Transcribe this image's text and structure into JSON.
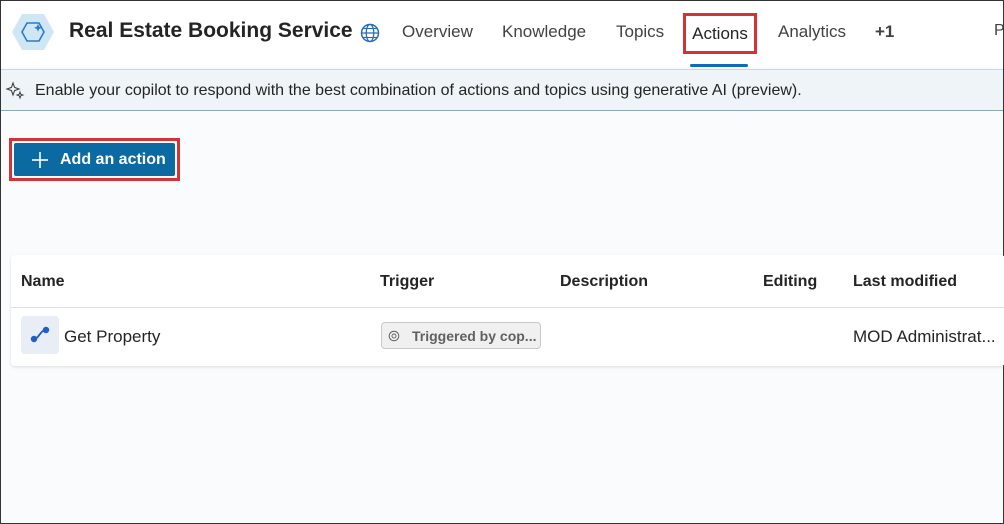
{
  "header": {
    "title": "Real Estate Booking Service",
    "app_icon": "copilot-hexagon-icon",
    "globe_icon": "globe-icon",
    "tabs": [
      {
        "label": "Overview"
      },
      {
        "label": "Knowledge"
      },
      {
        "label": "Topics"
      },
      {
        "label": "Actions",
        "active": true
      },
      {
        "label": "Analytics"
      },
      {
        "label": "+1"
      }
    ],
    "cut_tab_label": "P"
  },
  "banner": {
    "icon": "sparkle-icon",
    "text": "Enable your copilot to respond with the best combination of actions and topics using generative AI (preview)."
  },
  "toolbar": {
    "add_action_label": "Add an action",
    "add_icon": "plus-icon"
  },
  "table": {
    "columns": [
      "Name",
      "Trigger",
      "Description",
      "Editing",
      "Last modified"
    ],
    "rows": [
      {
        "icon": "flow-icon",
        "name": "Get Property",
        "trigger": "Triggered by cop...",
        "description": "",
        "editing": "",
        "last_modified": "MOD Administrat..."
      }
    ]
  },
  "colors": {
    "accent": "#0f6cbd",
    "button": "#0b6aa1",
    "highlight": "#d13438"
  }
}
